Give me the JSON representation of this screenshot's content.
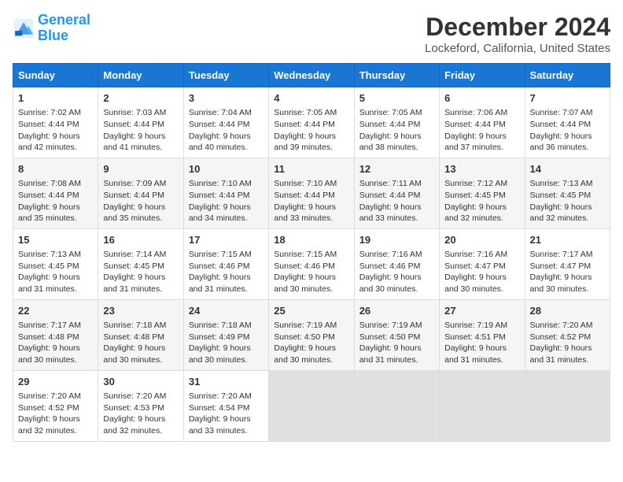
{
  "logo": {
    "line1": "General",
    "line2": "Blue"
  },
  "title": "December 2024",
  "subtitle": "Lockeford, California, United States",
  "days_header": [
    "Sunday",
    "Monday",
    "Tuesday",
    "Wednesday",
    "Thursday",
    "Friday",
    "Saturday"
  ],
  "weeks": [
    [
      {
        "day": "1",
        "info": "Sunrise: 7:02 AM\nSunset: 4:44 PM\nDaylight: 9 hours\nand 42 minutes."
      },
      {
        "day": "2",
        "info": "Sunrise: 7:03 AM\nSunset: 4:44 PM\nDaylight: 9 hours\nand 41 minutes."
      },
      {
        "day": "3",
        "info": "Sunrise: 7:04 AM\nSunset: 4:44 PM\nDaylight: 9 hours\nand 40 minutes."
      },
      {
        "day": "4",
        "info": "Sunrise: 7:05 AM\nSunset: 4:44 PM\nDaylight: 9 hours\nand 39 minutes."
      },
      {
        "day": "5",
        "info": "Sunrise: 7:05 AM\nSunset: 4:44 PM\nDaylight: 9 hours\nand 38 minutes."
      },
      {
        "day": "6",
        "info": "Sunrise: 7:06 AM\nSunset: 4:44 PM\nDaylight: 9 hours\nand 37 minutes."
      },
      {
        "day": "7",
        "info": "Sunrise: 7:07 AM\nSunset: 4:44 PM\nDaylight: 9 hours\nand 36 minutes."
      }
    ],
    [
      {
        "day": "8",
        "info": "Sunrise: 7:08 AM\nSunset: 4:44 PM\nDaylight: 9 hours\nand 35 minutes."
      },
      {
        "day": "9",
        "info": "Sunrise: 7:09 AM\nSunset: 4:44 PM\nDaylight: 9 hours\nand 35 minutes."
      },
      {
        "day": "10",
        "info": "Sunrise: 7:10 AM\nSunset: 4:44 PM\nDaylight: 9 hours\nand 34 minutes."
      },
      {
        "day": "11",
        "info": "Sunrise: 7:10 AM\nSunset: 4:44 PM\nDaylight: 9 hours\nand 33 minutes."
      },
      {
        "day": "12",
        "info": "Sunrise: 7:11 AM\nSunset: 4:44 PM\nDaylight: 9 hours\nand 33 minutes."
      },
      {
        "day": "13",
        "info": "Sunrise: 7:12 AM\nSunset: 4:45 PM\nDaylight: 9 hours\nand 32 minutes."
      },
      {
        "day": "14",
        "info": "Sunrise: 7:13 AM\nSunset: 4:45 PM\nDaylight: 9 hours\nand 32 minutes."
      }
    ],
    [
      {
        "day": "15",
        "info": "Sunrise: 7:13 AM\nSunset: 4:45 PM\nDaylight: 9 hours\nand 31 minutes."
      },
      {
        "day": "16",
        "info": "Sunrise: 7:14 AM\nSunset: 4:45 PM\nDaylight: 9 hours\nand 31 minutes."
      },
      {
        "day": "17",
        "info": "Sunrise: 7:15 AM\nSunset: 4:46 PM\nDaylight: 9 hours\nand 31 minutes."
      },
      {
        "day": "18",
        "info": "Sunrise: 7:15 AM\nSunset: 4:46 PM\nDaylight: 9 hours\nand 30 minutes."
      },
      {
        "day": "19",
        "info": "Sunrise: 7:16 AM\nSunset: 4:46 PM\nDaylight: 9 hours\nand 30 minutes."
      },
      {
        "day": "20",
        "info": "Sunrise: 7:16 AM\nSunset: 4:47 PM\nDaylight: 9 hours\nand 30 minutes."
      },
      {
        "day": "21",
        "info": "Sunrise: 7:17 AM\nSunset: 4:47 PM\nDaylight: 9 hours\nand 30 minutes."
      }
    ],
    [
      {
        "day": "22",
        "info": "Sunrise: 7:17 AM\nSunset: 4:48 PM\nDaylight: 9 hours\nand 30 minutes."
      },
      {
        "day": "23",
        "info": "Sunrise: 7:18 AM\nSunset: 4:48 PM\nDaylight: 9 hours\nand 30 minutes."
      },
      {
        "day": "24",
        "info": "Sunrise: 7:18 AM\nSunset: 4:49 PM\nDaylight: 9 hours\nand 30 minutes."
      },
      {
        "day": "25",
        "info": "Sunrise: 7:19 AM\nSunset: 4:50 PM\nDaylight: 9 hours\nand 30 minutes."
      },
      {
        "day": "26",
        "info": "Sunrise: 7:19 AM\nSunset: 4:50 PM\nDaylight: 9 hours\nand 31 minutes."
      },
      {
        "day": "27",
        "info": "Sunrise: 7:19 AM\nSunset: 4:51 PM\nDaylight: 9 hours\nand 31 minutes."
      },
      {
        "day": "28",
        "info": "Sunrise: 7:20 AM\nSunset: 4:52 PM\nDaylight: 9 hours\nand 31 minutes."
      }
    ],
    [
      {
        "day": "29",
        "info": "Sunrise: 7:20 AM\nSunset: 4:52 PM\nDaylight: 9 hours\nand 32 minutes."
      },
      {
        "day": "30",
        "info": "Sunrise: 7:20 AM\nSunset: 4:53 PM\nDaylight: 9 hours\nand 32 minutes."
      },
      {
        "day": "31",
        "info": "Sunrise: 7:20 AM\nSunset: 4:54 PM\nDaylight: 9 hours\nand 33 minutes."
      },
      {
        "day": "",
        "info": ""
      },
      {
        "day": "",
        "info": ""
      },
      {
        "day": "",
        "info": ""
      },
      {
        "day": "",
        "info": ""
      }
    ]
  ]
}
